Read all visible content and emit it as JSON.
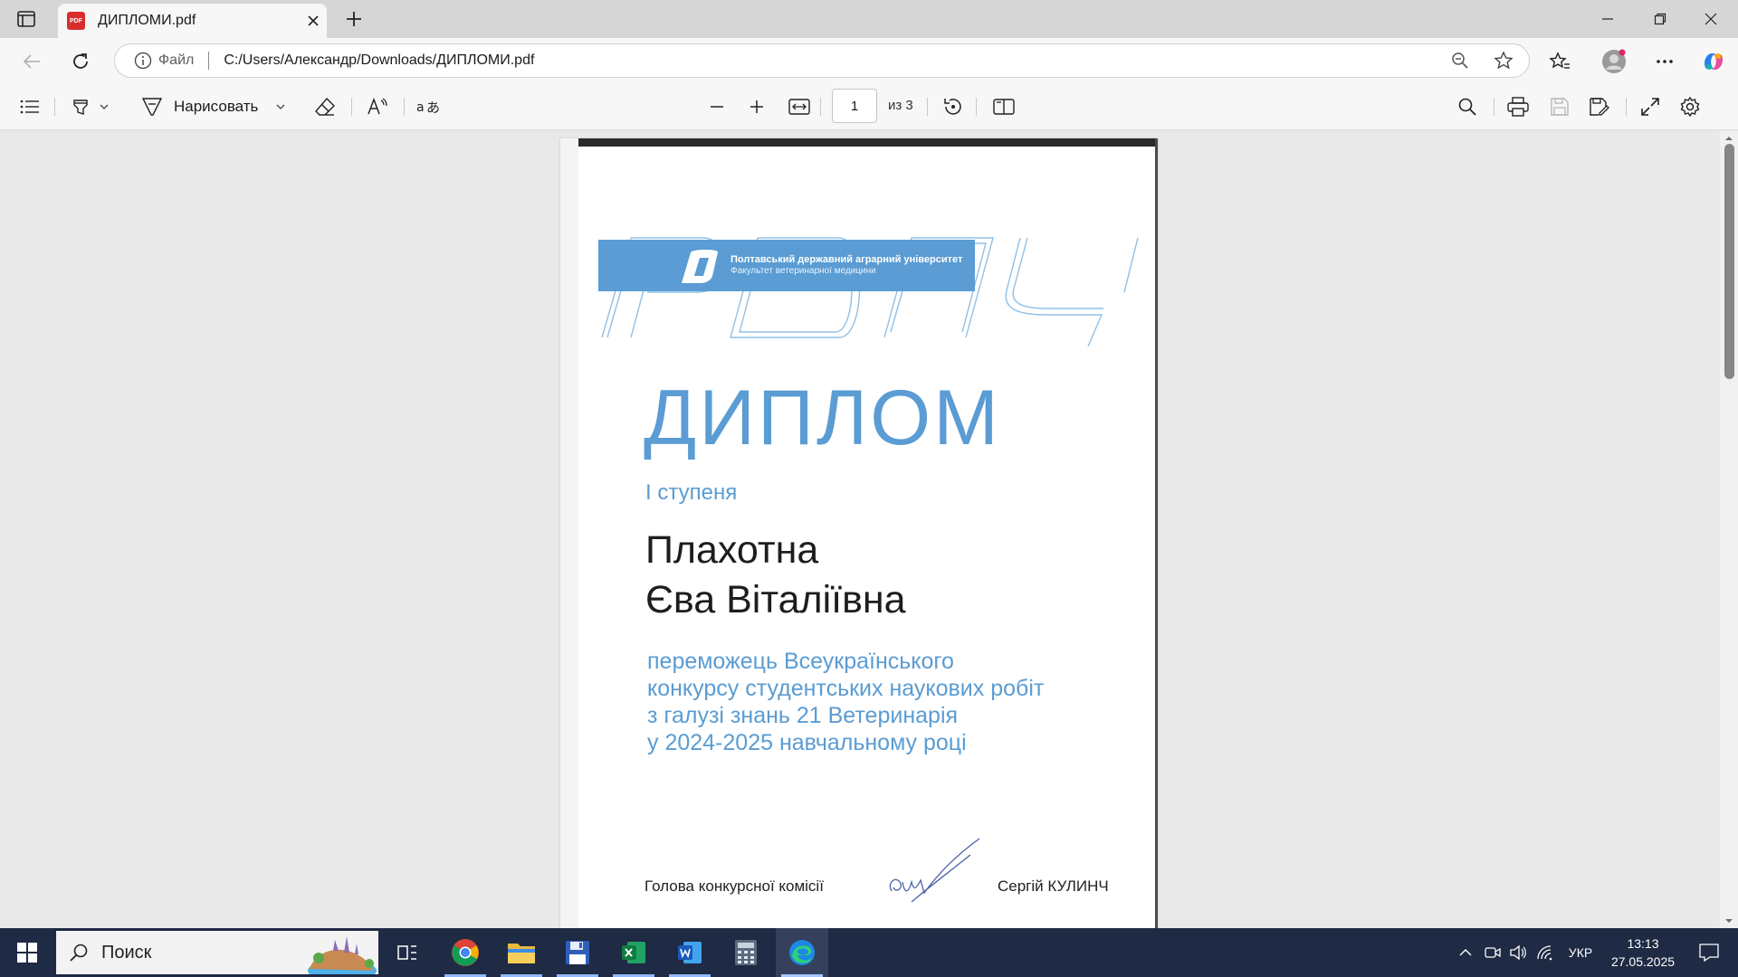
{
  "browser": {
    "tab_title": "ДИПЛОМИ.pdf",
    "tab_icon_label": "PDF",
    "address_scheme": "Файл",
    "address_url": "C:/Users/Александр/Downloads/ДИПЛОМИ.pdf"
  },
  "pdf_toolbar": {
    "draw_label": "Нарисовать",
    "page_current": "1",
    "page_count": "из 3"
  },
  "document": {
    "university_name": "Полтавський державний аграрний університет",
    "faculty_name": "Факультет ветеринарної медицини",
    "title": "ДИПЛОМ",
    "degree": "І ступеня",
    "name_line1": "Плахотна",
    "name_line2": "Єва Віталіївна",
    "desc_line1": "переможець Всеукраїнського",
    "desc_line2": "конкурсу студентських наукових робіт",
    "desc_line3": "з галузі знань 21 Ветеринарія",
    "desc_line4": "у 2024-2025 навчальному році",
    "footer_left": "Голова конкурсної комісії",
    "footer_right": "Сергій КУЛИНЧ"
  },
  "taskbar": {
    "search_placeholder": "Поиск",
    "language": "УКР",
    "time": "13:13",
    "date": "27.05.2025"
  },
  "colors": {
    "accent_blue": "#5a9cd3",
    "taskbar_bg": "#1f2a44"
  }
}
